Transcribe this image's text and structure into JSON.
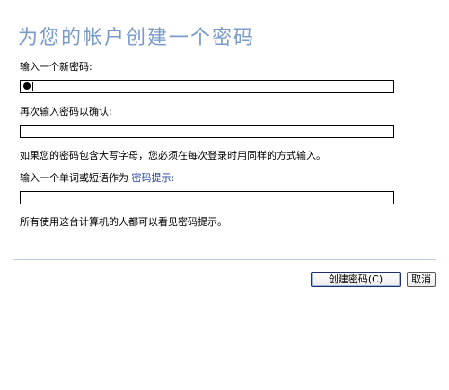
{
  "page": {
    "title": "为您的帐户创建一个密码"
  },
  "new_password": {
    "label": "输入一个新密码:"
  },
  "confirm_password": {
    "label": "再次输入密码以确认:"
  },
  "case_note": "如果您的密码包含大写字母，您必须在每次登录时用同样的方式输入。",
  "hint": {
    "label_prefix": "输入一个单词或短语作为",
    "link_text": "密码提示:"
  },
  "hint_note": "所有使用这台计算机的人都可以看见密码提示。",
  "buttons": {
    "create": "创建密码(C)",
    "cancel": "取消"
  },
  "colors": {
    "title": "#7a9ac8",
    "link": "#1f3f9a",
    "divider": "#bfcde3"
  }
}
